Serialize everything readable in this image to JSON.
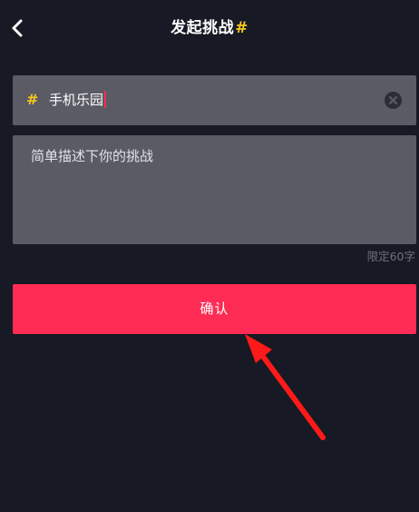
{
  "header": {
    "title": "发起挑战",
    "title_hash": "#",
    "back_icon": "chevron-left-icon"
  },
  "topic": {
    "hash": "#",
    "value": "手机乐园",
    "clear_icon": "clear-circle-icon"
  },
  "description": {
    "placeholder": "简单描述下你的挑战",
    "limit_hint": "限定60字"
  },
  "confirm": {
    "label": "确认"
  },
  "annotation": {
    "icon": "red-arrow-icon"
  },
  "colors": {
    "background": "#171924",
    "field": "#5a5b65",
    "accent": "#fe2c55",
    "hash": "#f7c81f",
    "annotation": "#ff1a1a"
  }
}
